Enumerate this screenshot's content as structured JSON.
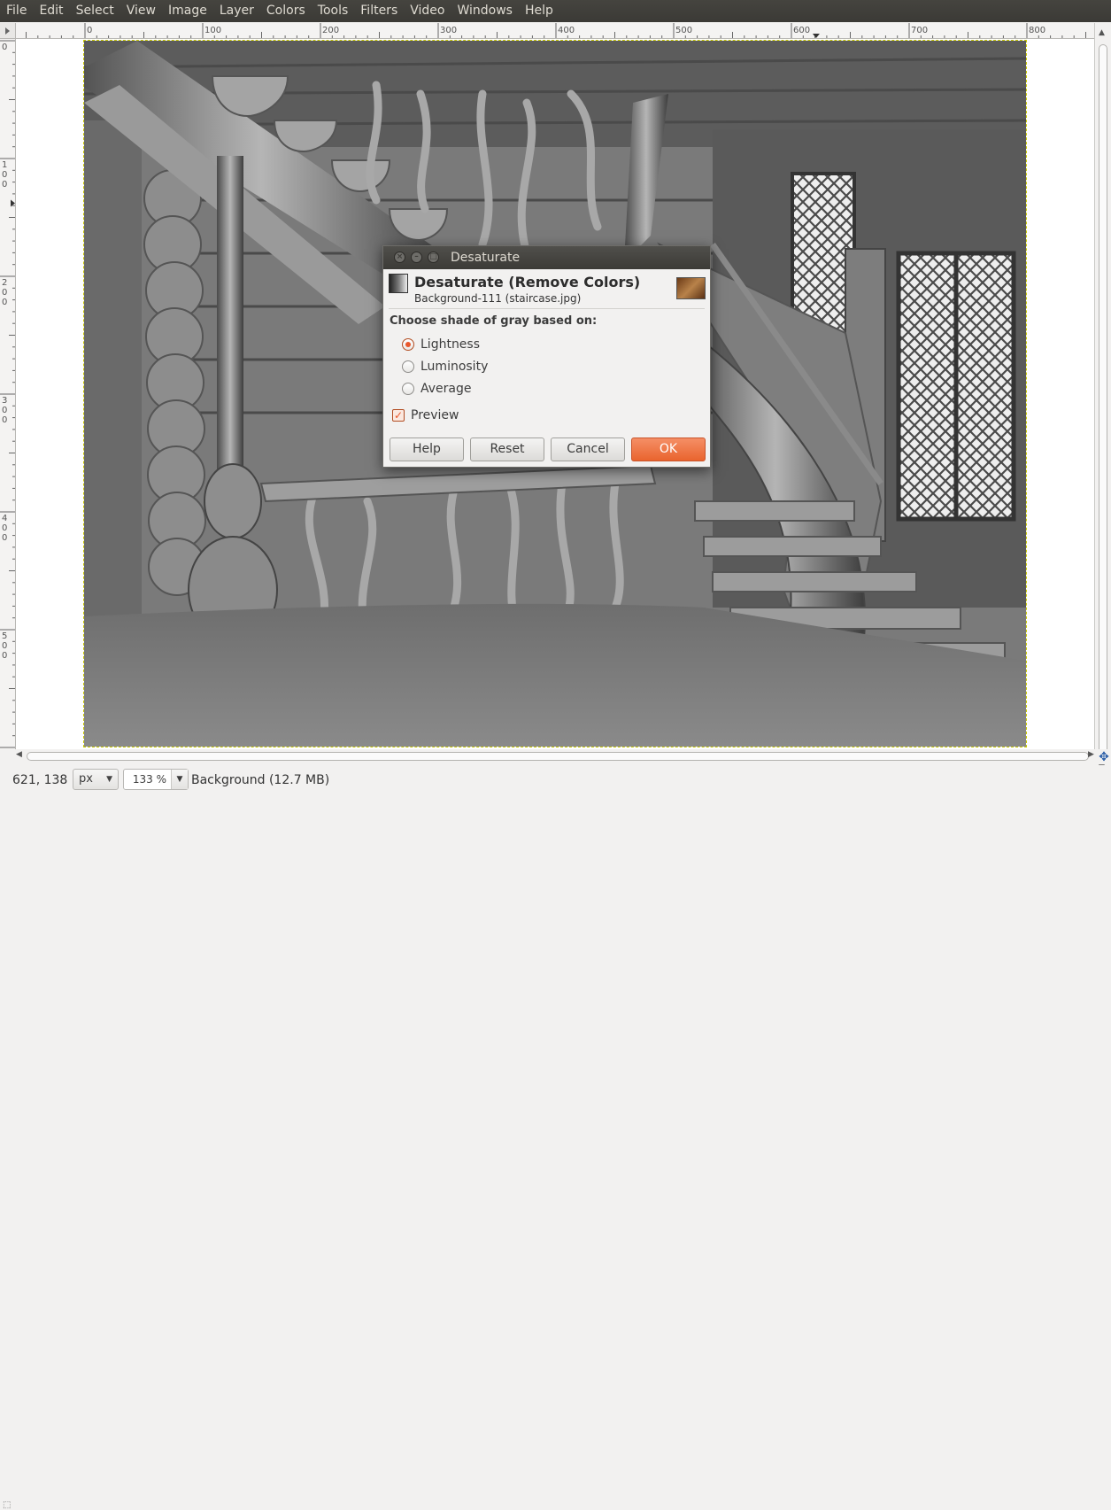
{
  "menu": [
    "File",
    "Edit",
    "Select",
    "View",
    "Image",
    "Layer",
    "Colors",
    "Tools",
    "Filters",
    "Video",
    "Windows",
    "Help"
  ],
  "ruler_h": {
    "labels": [
      {
        "value": 0,
        "text": "0"
      },
      {
        "value": 100,
        "text": "100"
      },
      {
        "value": 200,
        "text": "200"
      },
      {
        "value": 300,
        "text": "300"
      },
      {
        "value": 400,
        "text": "400"
      },
      {
        "value": 500,
        "text": "500"
      },
      {
        "value": 600,
        "text": "600"
      },
      {
        "value": 700,
        "text": "700"
      },
      {
        "value": 800,
        "text": "800"
      }
    ],
    "pointer_value": 621
  },
  "ruler_v": {
    "labels": [
      {
        "value": 0,
        "text": "0"
      },
      {
        "value": 100,
        "text": "100"
      },
      {
        "value": 200,
        "text": "200"
      },
      {
        "value": 300,
        "text": "300"
      },
      {
        "value": 400,
        "text": "400"
      },
      {
        "value": 500,
        "text": "500"
      }
    ],
    "pointer_value": 138
  },
  "dialog": {
    "window_title": "Desaturate",
    "header_title": "Desaturate (Remove Colors)",
    "header_subtitle": "Background-111 (staircase.jpg)",
    "section_label": "Choose shade of gray based on:",
    "options": [
      {
        "label": "Lightness",
        "selected": true
      },
      {
        "label": "Luminosity",
        "selected": false
      },
      {
        "label": "Average",
        "selected": false
      }
    ],
    "preview_label": "Preview",
    "preview_checked": true,
    "buttons": {
      "help": "Help",
      "reset": "Reset",
      "cancel": "Cancel",
      "ok": "OK"
    },
    "accent_color": "#e9572b"
  },
  "status": {
    "coords": "621, 138",
    "unit": "px",
    "zoom": "133 %",
    "message": "Background (12.7 MB)"
  },
  "icons": {
    "navigate": "navigate-icon",
    "quick_mask": "quick-mask-icon"
  }
}
